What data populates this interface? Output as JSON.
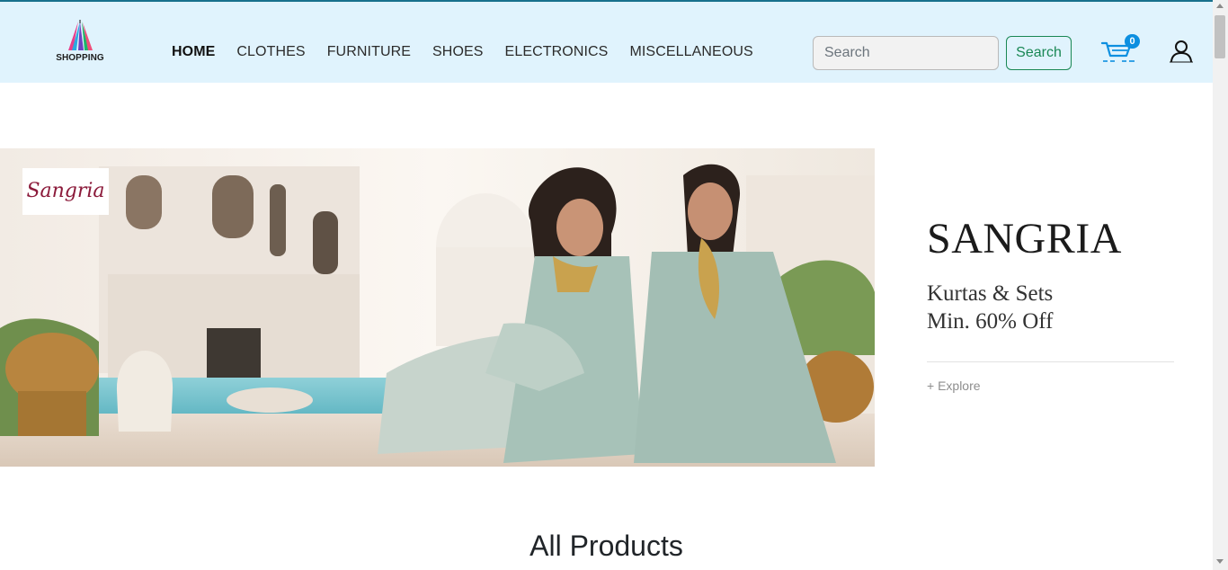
{
  "brand": {
    "name": "SHOPPING"
  },
  "nav": {
    "items": [
      {
        "label": "HOME",
        "active": true
      },
      {
        "label": "CLOTHES",
        "active": false
      },
      {
        "label": "FURNITURE",
        "active": false
      },
      {
        "label": "SHOES",
        "active": false
      },
      {
        "label": "ELECTRONICS",
        "active": false
      },
      {
        "label": "MISCELLANEOUS",
        "active": false
      }
    ]
  },
  "search": {
    "placeholder": "Search",
    "value": "",
    "button_label": "Search"
  },
  "cart": {
    "count": "0",
    "icon": "cart-icon"
  },
  "user": {
    "icon": "user-icon"
  },
  "banner": {
    "logo_text": "Sangria",
    "title": "SANGRIA",
    "line1": "Kurtas & Sets",
    "line2": "Min. 60% Off",
    "explore": "+ Explore"
  },
  "section": {
    "title": "All Products"
  },
  "colors": {
    "navbar_bg": "#e0f3fd",
    "accent_green": "#198754",
    "cart_blue": "#0d8fe0",
    "brand_text": "#8b1a3a"
  }
}
